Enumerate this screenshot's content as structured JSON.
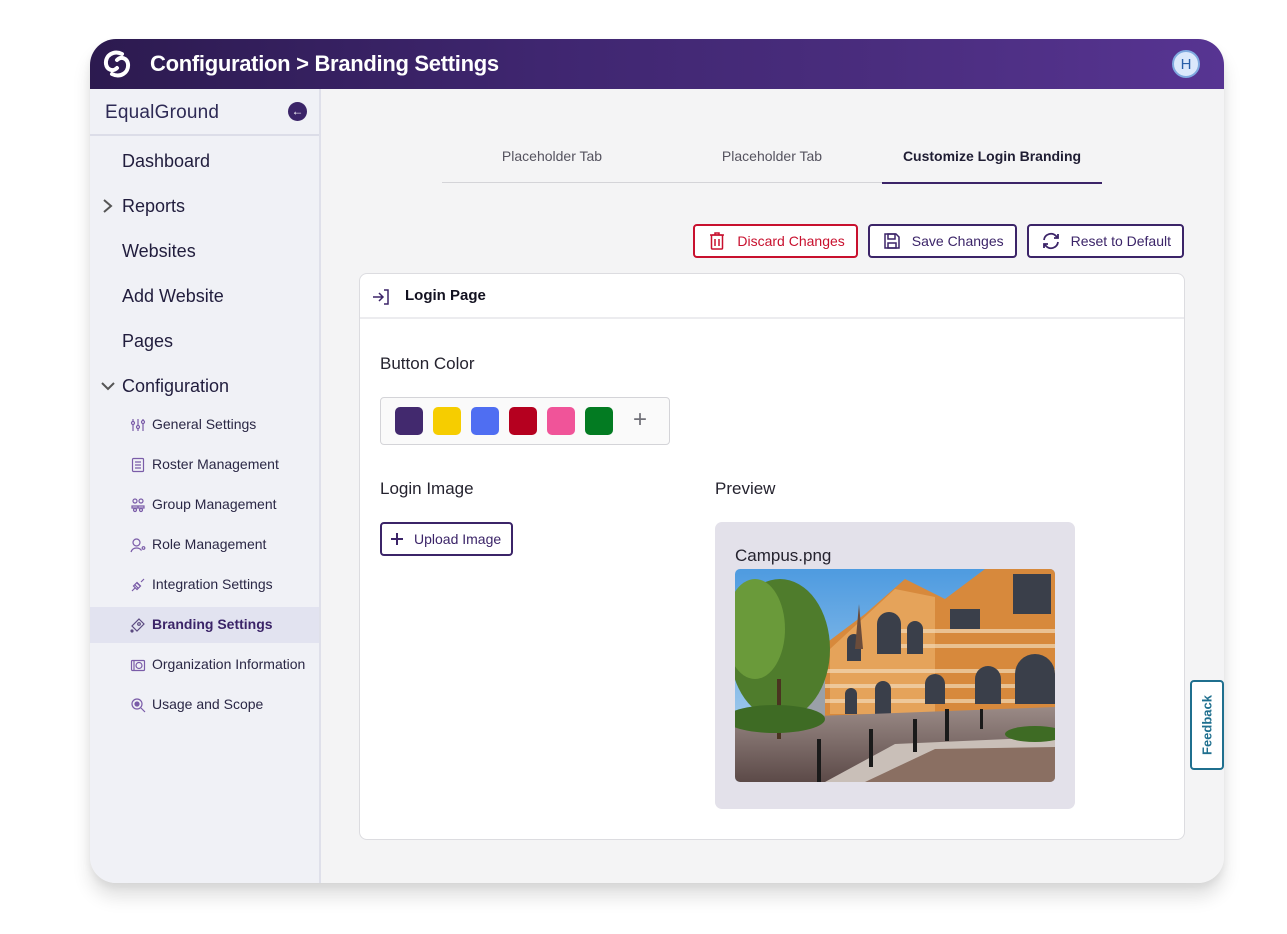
{
  "header": {
    "title": "Configuration > Branding Settings",
    "logo_icon": "equalground-logo-icon",
    "avatar_initial": "H",
    "colors": {
      "gradient_start": "#2c1a4f",
      "gradient_end": "#573492"
    }
  },
  "sidebar": {
    "org_name": "EqualGround",
    "collapse_icon": "arrow-left-icon",
    "items": [
      {
        "label": "Dashboard",
        "chevron": ""
      },
      {
        "label": "Reports",
        "chevron": "chevron-right-icon"
      },
      {
        "label": "Websites",
        "chevron": ""
      },
      {
        "label": "Add Website",
        "chevron": ""
      },
      {
        "label": "Pages",
        "chevron": ""
      },
      {
        "label": "Configuration",
        "chevron": "chevron-down-icon"
      }
    ],
    "sub_items": [
      {
        "label": "General Settings",
        "icon": "sliders-icon",
        "active": false
      },
      {
        "label": "Roster Management",
        "icon": "list-icon",
        "active": false
      },
      {
        "label": "Group Management",
        "icon": "group-icon",
        "active": false
      },
      {
        "label": "Role Management",
        "icon": "user-gear-icon",
        "active": false
      },
      {
        "label": "Integration Settings",
        "icon": "plug-icon",
        "active": false
      },
      {
        "label": "Branding Settings",
        "icon": "tag-icon",
        "active": true
      },
      {
        "label": "Organization Information",
        "icon": "org-id-icon",
        "active": false
      },
      {
        "label": "Usage and Scope",
        "icon": "magnifier-icon",
        "active": false
      }
    ]
  },
  "tabs": [
    {
      "label": "Placeholder Tab",
      "active": false
    },
    {
      "label": "Placeholder Tab",
      "active": false
    },
    {
      "label": "Customize Login Branding",
      "active": true
    }
  ],
  "actions": {
    "discard_label": "Discard Changes",
    "save_label": "Save Changes",
    "reset_label": "Reset to Default"
  },
  "card": {
    "title": "Login Page",
    "title_icon": "login-icon",
    "button_color_label": "Button Color",
    "swatches": [
      {
        "name": "purple",
        "hex": "#42296e",
        "selected": true
      },
      {
        "name": "yellow",
        "hex": "#f6cd00",
        "selected": false
      },
      {
        "name": "blue",
        "hex": "#4f6ef2",
        "selected": false
      },
      {
        "name": "red",
        "hex": "#b5001f",
        "selected": false
      },
      {
        "name": "pink",
        "hex": "#f05499",
        "selected": false
      },
      {
        "name": "green",
        "hex": "#037b22",
        "selected": false
      }
    ],
    "add_color_label": "+",
    "login_image_label": "Login Image",
    "upload_label": "Upload Image",
    "preview_label": "Preview",
    "file_name": "Campus.png"
  },
  "feedback_label": "Feedback"
}
